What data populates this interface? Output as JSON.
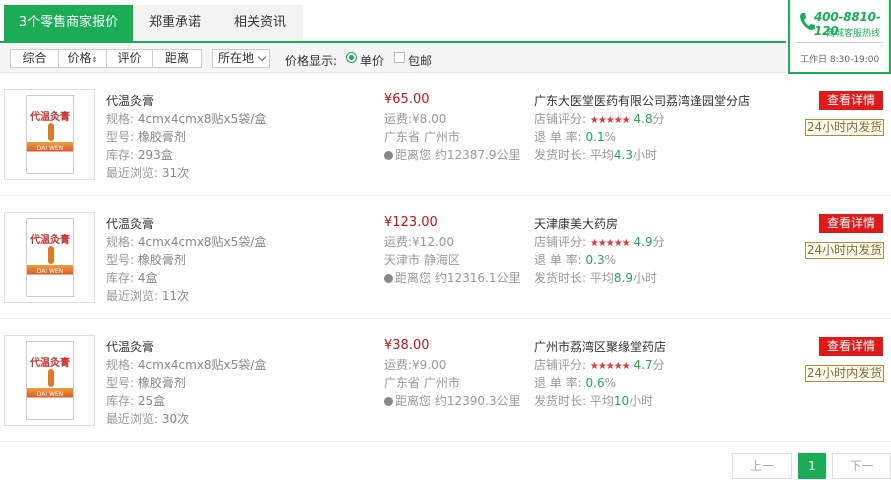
{
  "tabs": [
    {
      "label": "3个零售商家报价"
    },
    {
      "label": "郑重承诺"
    },
    {
      "label": "相关资讯"
    }
  ],
  "hotline": {
    "number": "400-8810-120",
    "subtitle": "商城客服热线",
    "hours": "工作日 8:30-19:00"
  },
  "filters": {
    "sort": [
      {
        "label": "综合"
      },
      {
        "label": "价格"
      },
      {
        "label": "评价"
      },
      {
        "label": "距离"
      }
    ],
    "location": "所在地",
    "price_display_label": "价格显示:",
    "unit_price": "单价",
    "free_shipping": "包邮"
  },
  "labels": {
    "spec": "规格:",
    "model": "型号:",
    "stock": "库存:",
    "recent": "最近浏览:",
    "freight": "运费:",
    "distance_prefix": "距离您 约",
    "rating": "店铺评分:",
    "return_rate": "退 单 率:",
    "ship_time": "发货时长:",
    "ship_prefix": "平均",
    "detail": "查看详情",
    "badge": "24小时内发货",
    "box_title": "代温灸膏",
    "box_sub": "DAI WEN"
  },
  "rows": [
    {
      "name": "代温灸膏",
      "spec": "4cmx4cmx8贴x5袋/盒",
      "model": "橡胶膏剂",
      "stock": "293盒",
      "recent": "31次",
      "price": "¥65.00",
      "freight": "¥8.00",
      "location": "广东省 广州市",
      "distance": "12387.9公里",
      "store": "广东大医堂医药有限公司荔湾逢园堂分店",
      "stars": "★★★★★",
      "score": "4.8",
      "score_unit": "分",
      "return_rate": "0.1",
      "return_unit": "%",
      "ship": "4.3",
      "ship_unit": "小时"
    },
    {
      "name": "代温灸膏",
      "spec": "4cmx4cmx8贴x5袋/盒",
      "model": "橡胶膏剂",
      "stock": "4盒",
      "recent": "11次",
      "price": "¥123.00",
      "freight": "¥12.00",
      "location": "天津市 静海区",
      "distance": "12316.1公里",
      "store": "天津康美大药房",
      "stars": "★★★★★",
      "score": "4.9",
      "score_unit": "分",
      "return_rate": "0.3",
      "return_unit": "%",
      "ship": "8.9",
      "ship_unit": "小时"
    },
    {
      "name": "代温灸膏",
      "spec": "4cmx4cmx8贴x5袋/盒",
      "model": "橡胶膏剂",
      "stock": "25盒",
      "recent": "30次",
      "price": "¥38.00",
      "freight": "¥9.00",
      "location": "广东省 广州市",
      "distance": "12390.3公里",
      "store": "广州市荔湾区聚缘堂药店",
      "stars": "★★★★★",
      "score": "4.7",
      "score_unit": "分",
      "return_rate": "0.6",
      "return_unit": "%",
      "ship": "10",
      "ship_unit": "小时"
    }
  ],
  "pagination": {
    "prev": "上一",
    "current": "1",
    "next": "下一"
  },
  "colors": {
    "accent": "#1aad56",
    "price": "#d01010",
    "button": "#e01a1a"
  }
}
